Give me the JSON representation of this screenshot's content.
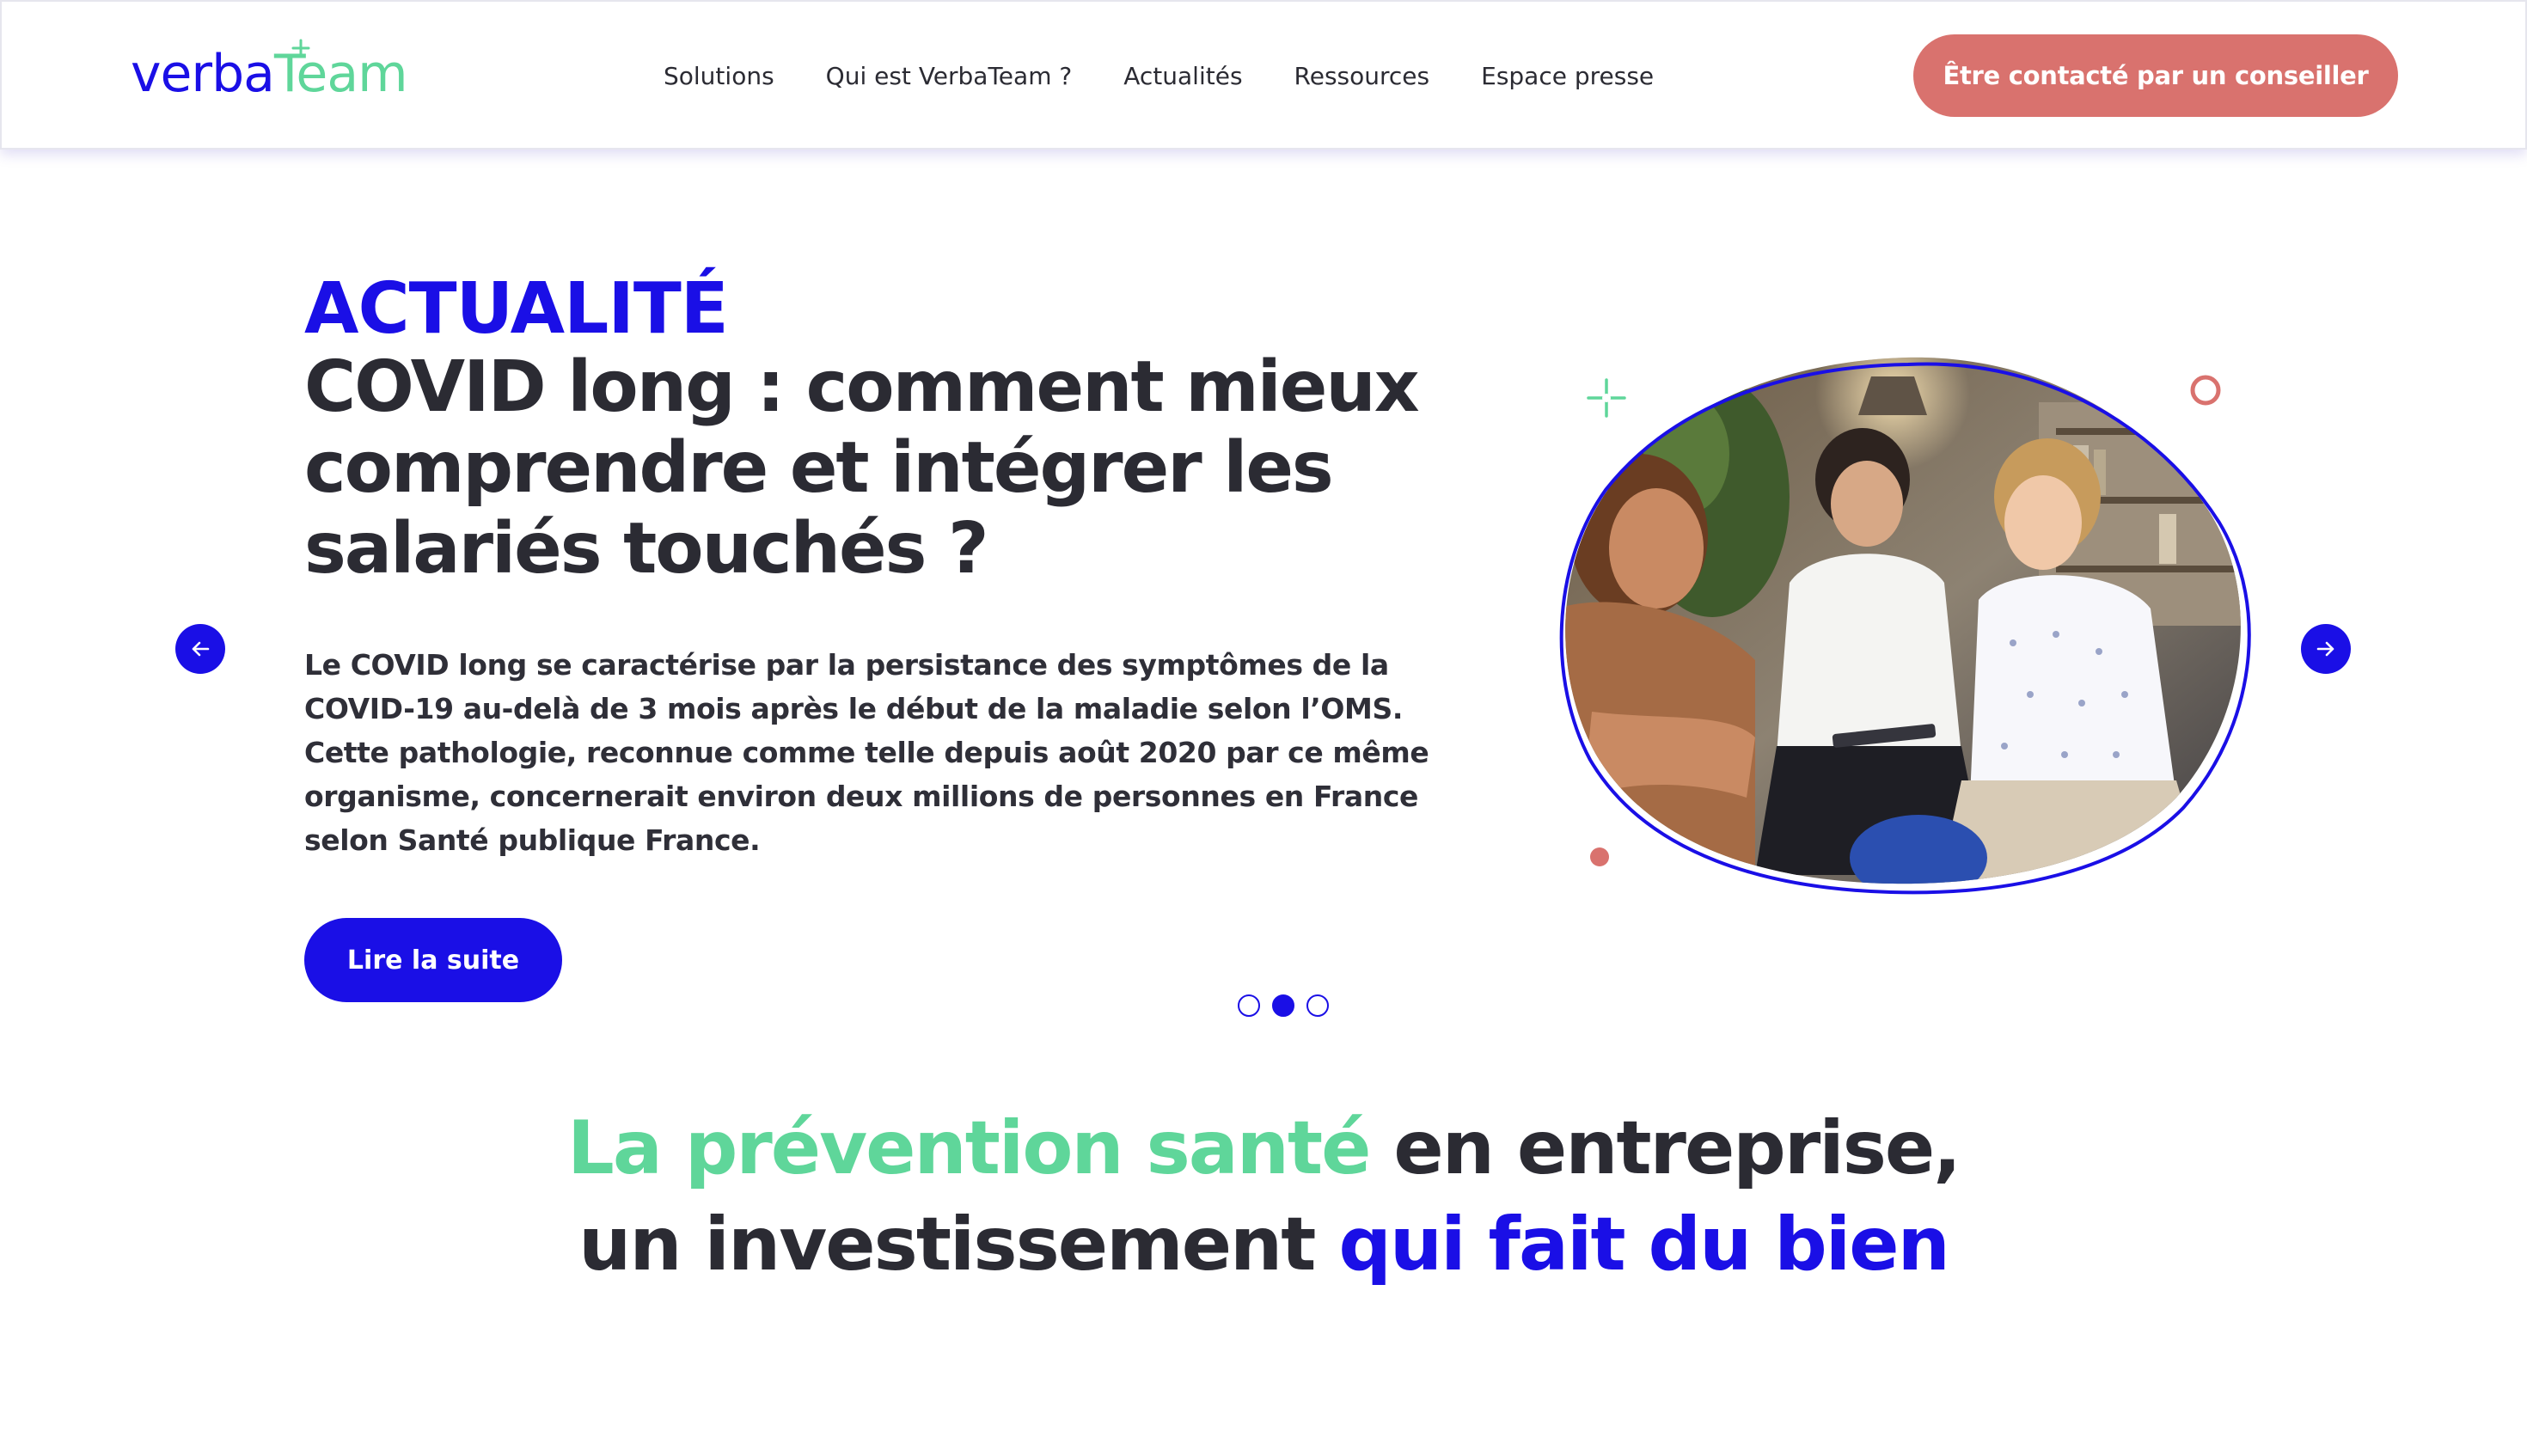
{
  "colors": {
    "brand_blue": "#1a0fe6",
    "brand_green": "#5fd69a",
    "coral": "#d9726e",
    "text_dark": "#2b2b33"
  },
  "header": {
    "logo": {
      "part1": "verba",
      "part2": "Team"
    },
    "nav": [
      {
        "label": "Solutions"
      },
      {
        "label": "Qui est VerbaTeam ?"
      },
      {
        "label": "Actualités"
      },
      {
        "label": "Ressources"
      },
      {
        "label": "Espace presse"
      }
    ],
    "cta_label": "Être contacté par un conseiller"
  },
  "hero": {
    "kicker": "ACTUALITÉ",
    "title": "COVID long : comment mieux comprendre et intégrer les salariés touchés ?",
    "text": "Le COVID long se caractérise par la persistance des symptômes de la COVID-19 au-delà de 3 mois après le début de la maladie selon l’OMS. Cette pathologie, reconnue comme telle depuis août 2020 par ce même organisme, concernerait environ deux millions de personnes en France selon Santé publique France.",
    "button_label": "Lire la suite",
    "prev_icon": "arrow-left-icon",
    "next_icon": "arrow-right-icon",
    "slides_total": 3,
    "active_slide": 2
  },
  "tagline": {
    "line1_green": "La prévention santé",
    "line1_dark": " en entreprise,",
    "line2_dark": "un investissement ",
    "line2_blue": "qui fait du bien"
  }
}
